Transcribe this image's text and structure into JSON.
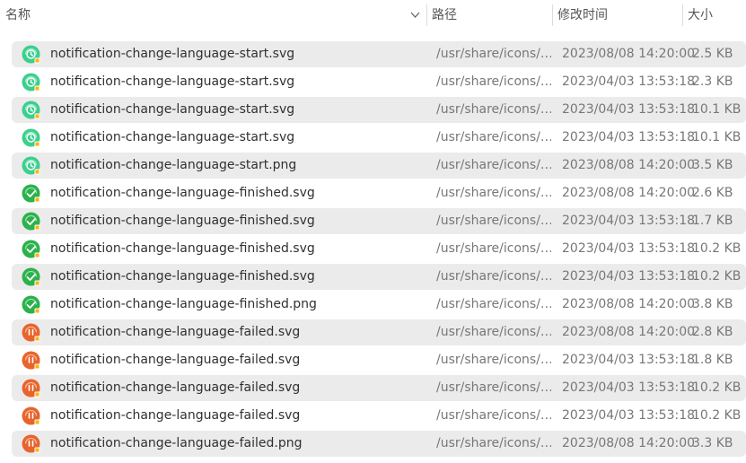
{
  "columns": {
    "name": "名称",
    "path": "路径",
    "modified": "修改时间",
    "size": "大小"
  },
  "colors": {
    "start": "#3ccf8e",
    "finished": "#2bb24c",
    "failed": "#e8642c",
    "badge": "#ffb300"
  },
  "files": [
    {
      "name": "notification-change-language-start.svg",
      "path": "/usr/share/icons/…",
      "modified": "2023/08/08 14:20:00",
      "size": "2.5 KB",
      "icon": "language-start-icon"
    },
    {
      "name": "notification-change-language-start.svg",
      "path": "/usr/share/icons/…",
      "modified": "2023/04/03 13:53:18",
      "size": "2.3 KB",
      "icon": "language-start-icon"
    },
    {
      "name": "notification-change-language-start.svg",
      "path": "/usr/share/icons/…",
      "modified": "2023/04/03 13:53:18",
      "size": "10.1 KB",
      "icon": "language-start-icon"
    },
    {
      "name": "notification-change-language-start.svg",
      "path": "/usr/share/icons/…",
      "modified": "2023/04/03 13:53:18",
      "size": "10.1 KB",
      "icon": "language-start-icon"
    },
    {
      "name": "notification-change-language-start.png",
      "path": "/usr/share/icons/…",
      "modified": "2023/08/08 14:20:00",
      "size": "3.5 KB",
      "icon": "language-start-icon"
    },
    {
      "name": "notification-change-language-finished.svg",
      "path": "/usr/share/icons/…",
      "modified": "2023/08/08 14:20:00",
      "size": "2.6 KB",
      "icon": "language-finished-icon"
    },
    {
      "name": "notification-change-language-finished.svg",
      "path": "/usr/share/icons/…",
      "modified": "2023/04/03 13:53:18",
      "size": "1.7 KB",
      "icon": "language-finished-icon"
    },
    {
      "name": "notification-change-language-finished.svg",
      "path": "/usr/share/icons/…",
      "modified": "2023/04/03 13:53:18",
      "size": "10.2 KB",
      "icon": "language-finished-icon"
    },
    {
      "name": "notification-change-language-finished.svg",
      "path": "/usr/share/icons/…",
      "modified": "2023/04/03 13:53:18",
      "size": "10.2 KB",
      "icon": "language-finished-icon"
    },
    {
      "name": "notification-change-language-finished.png",
      "path": "/usr/share/icons/…",
      "modified": "2023/08/08 14:20:00",
      "size": "3.8 KB",
      "icon": "language-finished-icon"
    },
    {
      "name": "notification-change-language-failed.svg",
      "path": "/usr/share/icons/…",
      "modified": "2023/08/08 14:20:00",
      "size": "2.8 KB",
      "icon": "language-failed-icon"
    },
    {
      "name": "notification-change-language-failed.svg",
      "path": "/usr/share/icons/…",
      "modified": "2023/04/03 13:53:18",
      "size": "1.8 KB",
      "icon": "language-failed-icon"
    },
    {
      "name": "notification-change-language-failed.svg",
      "path": "/usr/share/icons/…",
      "modified": "2023/04/03 13:53:18",
      "size": "10.2 KB",
      "icon": "language-failed-icon"
    },
    {
      "name": "notification-change-language-failed.svg",
      "path": "/usr/share/icons/…",
      "modified": "2023/04/03 13:53:18",
      "size": "10.2 KB",
      "icon": "language-failed-icon"
    },
    {
      "name": "notification-change-language-failed.png",
      "path": "/usr/share/icons/…",
      "modified": "2023/08/08 14:20:00",
      "size": "3.3 KB",
      "icon": "language-failed-icon"
    }
  ]
}
